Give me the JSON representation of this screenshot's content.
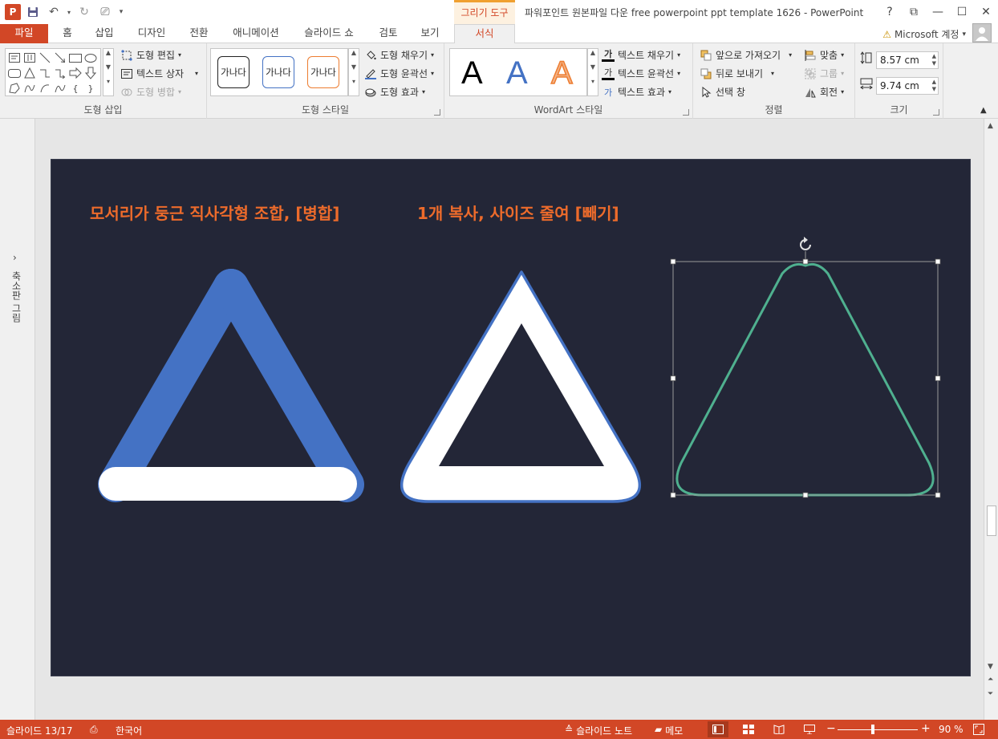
{
  "titlebar": {
    "context_tab": "그리기 도구",
    "title": "파워포인트 원본파일 다운 free powerpoint ppt template 1626 - PowerPoint",
    "help": "?",
    "ribbon_display": "⧉",
    "minimize": "—",
    "maximize": "☐",
    "close": "✕"
  },
  "tabs": [
    "파일",
    "홈",
    "삽입",
    "디자인",
    "전환",
    "애니메이션",
    "슬라이드 쇼",
    "검토",
    "보기",
    "서식"
  ],
  "account": {
    "warning": "⚠",
    "label": "Microsoft 계정",
    "caret": "▾"
  },
  "ribbon": {
    "insert_shapes": {
      "label": "도형 삽입",
      "edit_shape": "도형 편집",
      "text_box": "텍스트 상자",
      "merge_shapes": "도형 병합"
    },
    "shape_styles": {
      "label": "도형 스타일",
      "swatch_text": "가나다",
      "fill": "도형 채우기",
      "outline": "도형 윤곽선",
      "effects": "도형 효과"
    },
    "wordart": {
      "label": "WordArt 스타일",
      "letter": "A",
      "text_fill": "텍스트 채우기",
      "text_outline": "텍스트 윤곽선",
      "text_effects": "텍스트 효과"
    },
    "arrange": {
      "label": "정렬",
      "bring_forward": "앞으로 가져오기",
      "send_backward": "뒤로 보내기",
      "selection_pane": "선택 창",
      "align": "맞춤",
      "group": "그룹",
      "rotate": "회전"
    },
    "size": {
      "label": "크기",
      "height": "8.57 cm",
      "width": "9.74 cm"
    }
  },
  "thumb_pane": {
    "label": "축소판 그림",
    "expand": "›"
  },
  "slide": {
    "heading_left": "모서리가 둥근 직사각형 조합, [병합]",
    "heading_right": "1개 복사, 사이즈 줄여 [빼기]",
    "colors": {
      "background": "#232637",
      "heading": "#ed6b2b",
      "blue": "#4472c4",
      "white": "#ffffff",
      "green": "#4fb08f",
      "selection": "#9a9a9a"
    }
  },
  "statusbar": {
    "slide_info": "슬라이드 13/17",
    "language": "한국어",
    "notes": "슬라이드 노트",
    "comments": "메모",
    "zoom_minus": "−",
    "zoom_plus": "+",
    "zoom": "90 %"
  }
}
